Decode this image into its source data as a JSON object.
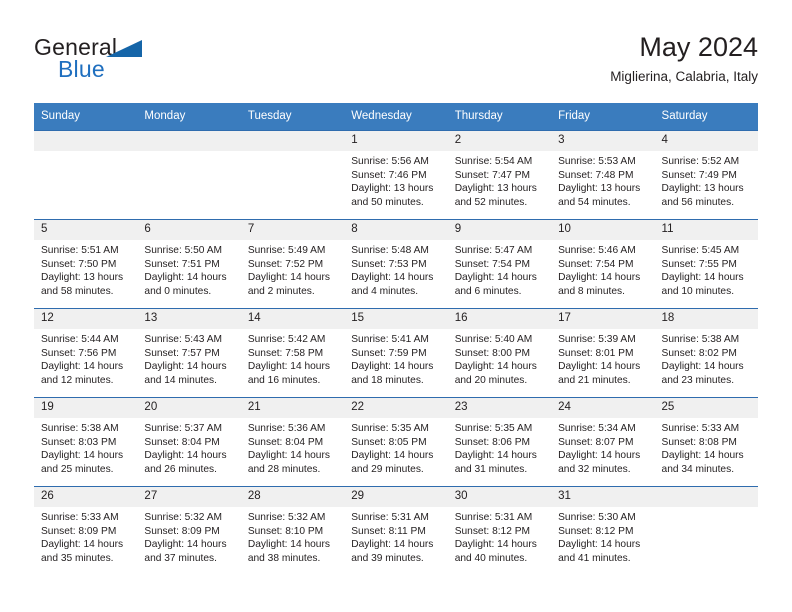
{
  "brand": {
    "name_top": "General",
    "name_bottom": "Blue",
    "flag_color": "#1565a8",
    "blue_text_color": "#1f6fbf"
  },
  "header": {
    "title": "May 2024",
    "subtitle": "Miglierina, Calabria, Italy"
  },
  "theme": {
    "header_row_bg": "#3a7cbe",
    "header_row_text": "#ffffff",
    "row_divider": "#2f6cae",
    "daynum_bg": "#f0f0f0",
    "body_text": "#231f20"
  },
  "weekday_headers": [
    "Sunday",
    "Monday",
    "Tuesday",
    "Wednesday",
    "Thursday",
    "Friday",
    "Saturday"
  ],
  "labels": {
    "sunrise_prefix": "Sunrise:",
    "sunset_prefix": "Sunset:",
    "daylight_prefix": "Daylight:"
  },
  "weeks": [
    [
      {
        "day": "",
        "empty": true
      },
      {
        "day": "",
        "empty": true
      },
      {
        "day": "",
        "empty": true
      },
      {
        "day": "1",
        "sunrise": "Sunrise: 5:56 AM",
        "sunset": "Sunset: 7:46 PM",
        "daylight": "Daylight: 13 hours and 50 minutes."
      },
      {
        "day": "2",
        "sunrise": "Sunrise: 5:54 AM",
        "sunset": "Sunset: 7:47 PM",
        "daylight": "Daylight: 13 hours and 52 minutes."
      },
      {
        "day": "3",
        "sunrise": "Sunrise: 5:53 AM",
        "sunset": "Sunset: 7:48 PM",
        "daylight": "Daylight: 13 hours and 54 minutes."
      },
      {
        "day": "4",
        "sunrise": "Sunrise: 5:52 AM",
        "sunset": "Sunset: 7:49 PM",
        "daylight": "Daylight: 13 hours and 56 minutes."
      }
    ],
    [
      {
        "day": "5",
        "sunrise": "Sunrise: 5:51 AM",
        "sunset": "Sunset: 7:50 PM",
        "daylight": "Daylight: 13 hours and 58 minutes."
      },
      {
        "day": "6",
        "sunrise": "Sunrise: 5:50 AM",
        "sunset": "Sunset: 7:51 PM",
        "daylight": "Daylight: 14 hours and 0 minutes."
      },
      {
        "day": "7",
        "sunrise": "Sunrise: 5:49 AM",
        "sunset": "Sunset: 7:52 PM",
        "daylight": "Daylight: 14 hours and 2 minutes."
      },
      {
        "day": "8",
        "sunrise": "Sunrise: 5:48 AM",
        "sunset": "Sunset: 7:53 PM",
        "daylight": "Daylight: 14 hours and 4 minutes."
      },
      {
        "day": "9",
        "sunrise": "Sunrise: 5:47 AM",
        "sunset": "Sunset: 7:54 PM",
        "daylight": "Daylight: 14 hours and 6 minutes."
      },
      {
        "day": "10",
        "sunrise": "Sunrise: 5:46 AM",
        "sunset": "Sunset: 7:54 PM",
        "daylight": "Daylight: 14 hours and 8 minutes."
      },
      {
        "day": "11",
        "sunrise": "Sunrise: 5:45 AM",
        "sunset": "Sunset: 7:55 PM",
        "daylight": "Daylight: 14 hours and 10 minutes."
      }
    ],
    [
      {
        "day": "12",
        "sunrise": "Sunrise: 5:44 AM",
        "sunset": "Sunset: 7:56 PM",
        "daylight": "Daylight: 14 hours and 12 minutes."
      },
      {
        "day": "13",
        "sunrise": "Sunrise: 5:43 AM",
        "sunset": "Sunset: 7:57 PM",
        "daylight": "Daylight: 14 hours and 14 minutes."
      },
      {
        "day": "14",
        "sunrise": "Sunrise: 5:42 AM",
        "sunset": "Sunset: 7:58 PM",
        "daylight": "Daylight: 14 hours and 16 minutes."
      },
      {
        "day": "15",
        "sunrise": "Sunrise: 5:41 AM",
        "sunset": "Sunset: 7:59 PM",
        "daylight": "Daylight: 14 hours and 18 minutes."
      },
      {
        "day": "16",
        "sunrise": "Sunrise: 5:40 AM",
        "sunset": "Sunset: 8:00 PM",
        "daylight": "Daylight: 14 hours and 20 minutes."
      },
      {
        "day": "17",
        "sunrise": "Sunrise: 5:39 AM",
        "sunset": "Sunset: 8:01 PM",
        "daylight": "Daylight: 14 hours and 21 minutes."
      },
      {
        "day": "18",
        "sunrise": "Sunrise: 5:38 AM",
        "sunset": "Sunset: 8:02 PM",
        "daylight": "Daylight: 14 hours and 23 minutes."
      }
    ],
    [
      {
        "day": "19",
        "sunrise": "Sunrise: 5:38 AM",
        "sunset": "Sunset: 8:03 PM",
        "daylight": "Daylight: 14 hours and 25 minutes."
      },
      {
        "day": "20",
        "sunrise": "Sunrise: 5:37 AM",
        "sunset": "Sunset: 8:04 PM",
        "daylight": "Daylight: 14 hours and 26 minutes."
      },
      {
        "day": "21",
        "sunrise": "Sunrise: 5:36 AM",
        "sunset": "Sunset: 8:04 PM",
        "daylight": "Daylight: 14 hours and 28 minutes."
      },
      {
        "day": "22",
        "sunrise": "Sunrise: 5:35 AM",
        "sunset": "Sunset: 8:05 PM",
        "daylight": "Daylight: 14 hours and 29 minutes."
      },
      {
        "day": "23",
        "sunrise": "Sunrise: 5:35 AM",
        "sunset": "Sunset: 8:06 PM",
        "daylight": "Daylight: 14 hours and 31 minutes."
      },
      {
        "day": "24",
        "sunrise": "Sunrise: 5:34 AM",
        "sunset": "Sunset: 8:07 PM",
        "daylight": "Daylight: 14 hours and 32 minutes."
      },
      {
        "day": "25",
        "sunrise": "Sunrise: 5:33 AM",
        "sunset": "Sunset: 8:08 PM",
        "daylight": "Daylight: 14 hours and 34 minutes."
      }
    ],
    [
      {
        "day": "26",
        "sunrise": "Sunrise: 5:33 AM",
        "sunset": "Sunset: 8:09 PM",
        "daylight": "Daylight: 14 hours and 35 minutes."
      },
      {
        "day": "27",
        "sunrise": "Sunrise: 5:32 AM",
        "sunset": "Sunset: 8:09 PM",
        "daylight": "Daylight: 14 hours and 37 minutes."
      },
      {
        "day": "28",
        "sunrise": "Sunrise: 5:32 AM",
        "sunset": "Sunset: 8:10 PM",
        "daylight": "Daylight: 14 hours and 38 minutes."
      },
      {
        "day": "29",
        "sunrise": "Sunrise: 5:31 AM",
        "sunset": "Sunset: 8:11 PM",
        "daylight": "Daylight: 14 hours and 39 minutes."
      },
      {
        "day": "30",
        "sunrise": "Sunrise: 5:31 AM",
        "sunset": "Sunset: 8:12 PM",
        "daylight": "Daylight: 14 hours and 40 minutes."
      },
      {
        "day": "31",
        "sunrise": "Sunrise: 5:30 AM",
        "sunset": "Sunset: 8:12 PM",
        "daylight": "Daylight: 14 hours and 41 minutes."
      },
      {
        "day": "",
        "empty": true
      }
    ]
  ]
}
